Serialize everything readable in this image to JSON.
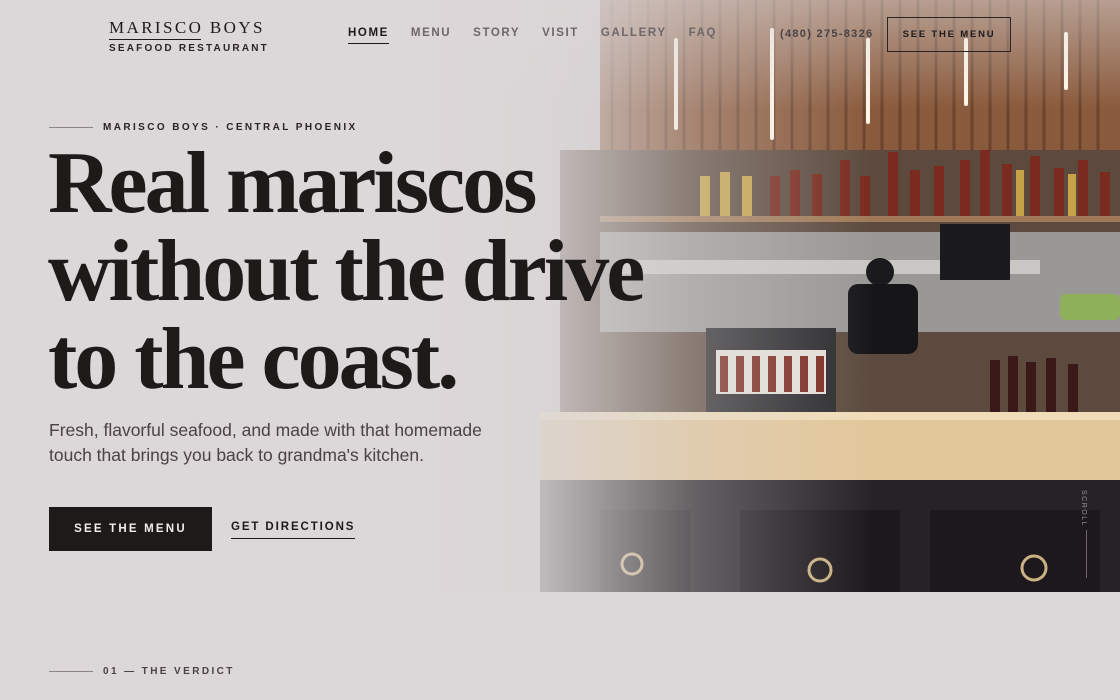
{
  "brand": {
    "name": "MARISCO BOYS",
    "tagline": "SEAFOOD RESTAURANT"
  },
  "nav": {
    "items": [
      "HOME",
      "MENU",
      "STORY",
      "VISIT",
      "GALLERY",
      "FAQ"
    ],
    "active": "HOME"
  },
  "header": {
    "phone": "(480) 275-8326",
    "cta_label": "SEE THE MENU"
  },
  "hero": {
    "eyebrow": "MARISCO BOYS · CENTRAL PHOENIX",
    "headline": [
      "Real mariscos",
      "without the drive",
      "to the coast."
    ],
    "subtext": "Fresh, flavorful seafood, and made with that homemade touch that brings you back to grandma's kitchen.",
    "primary_cta": "SEE THE MENU",
    "secondary_cta": "GET DIRECTIONS",
    "scroll_label": "SCROLL"
  },
  "next_section": {
    "label": "01 — THE VERDICT"
  },
  "colors": {
    "background": "#dcd7d8",
    "ink": "#1e1a1a",
    "muted": "#6e6668"
  }
}
